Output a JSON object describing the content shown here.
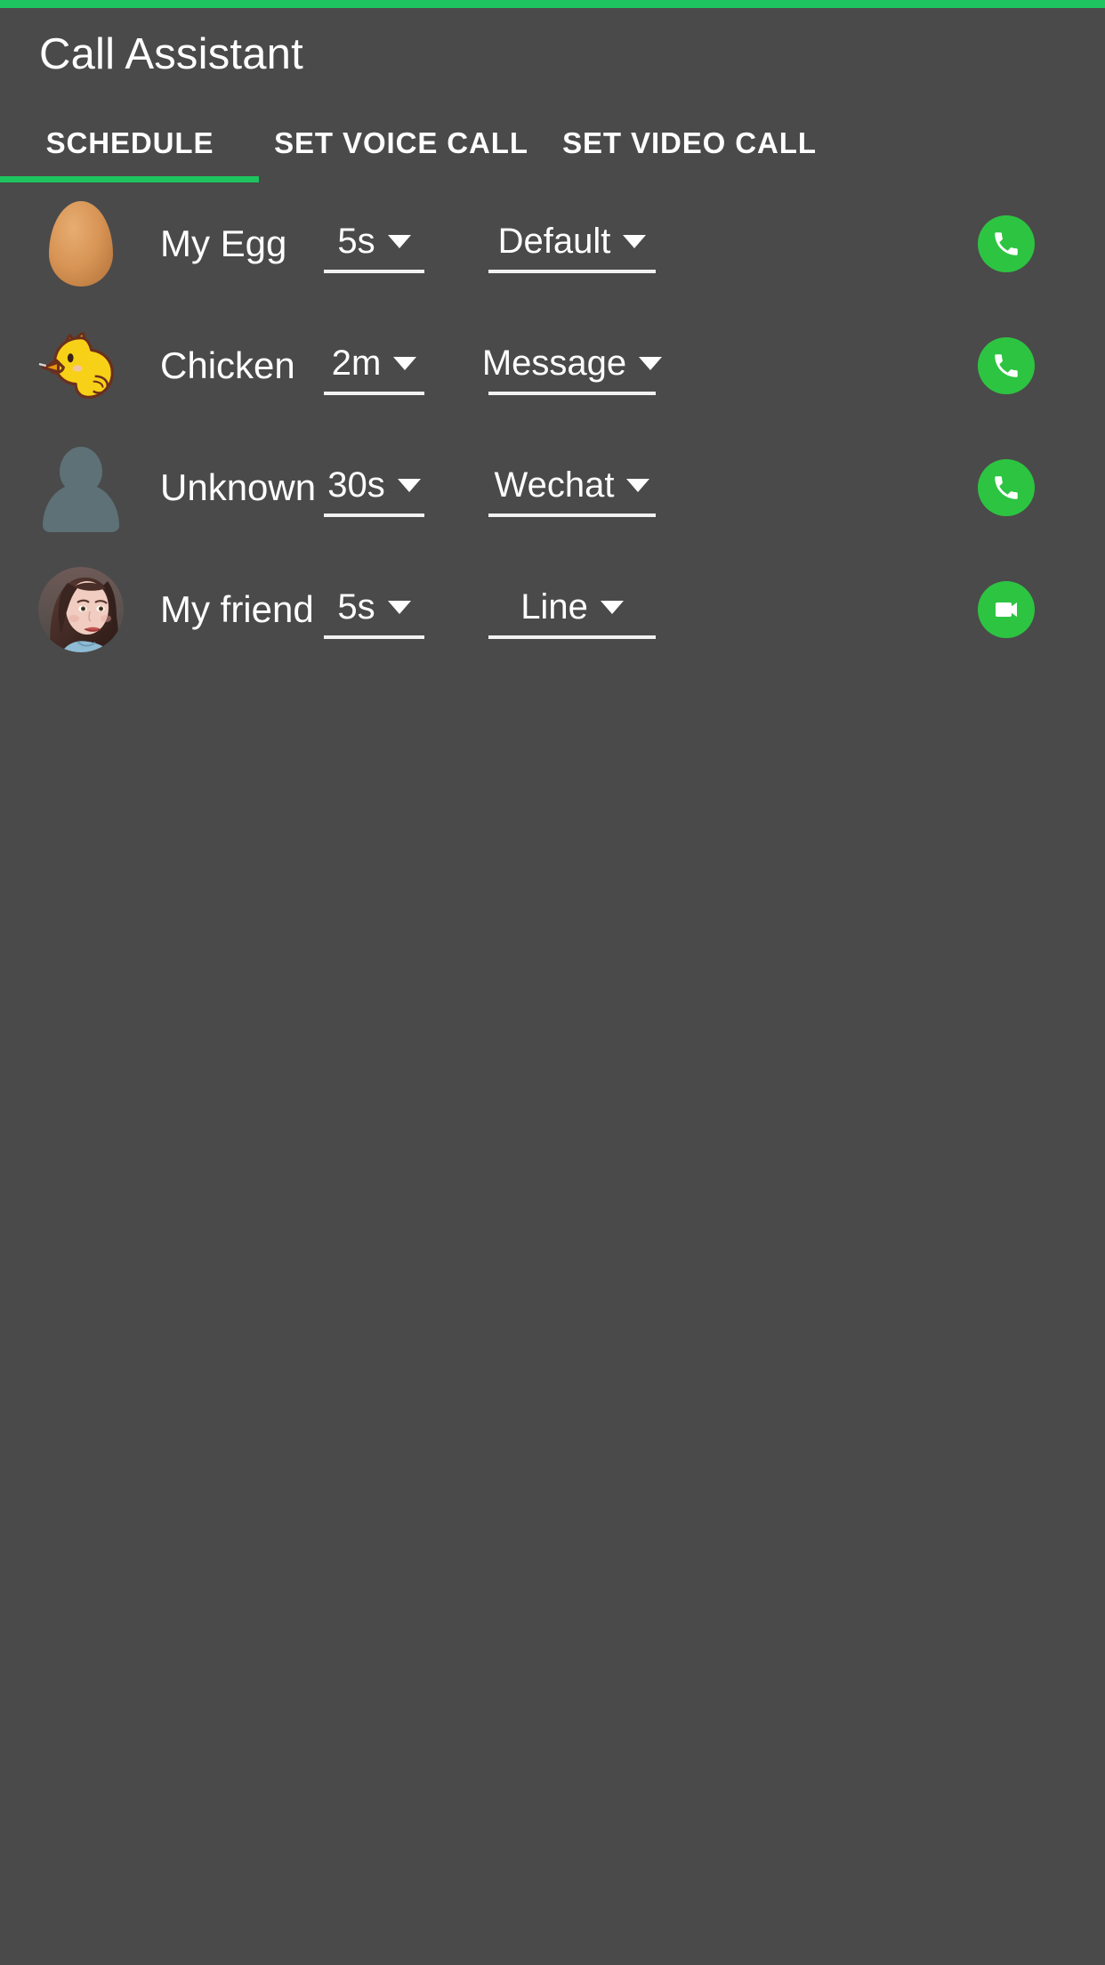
{
  "theme": {
    "background": "#4a4a4a",
    "accent_green": "#1ec45f",
    "action_green": "#2dc442",
    "text_primary": "#ffffff"
  },
  "app_bar": {
    "title": "Call Assistant"
  },
  "tabs": [
    {
      "label": "SCHEDULE",
      "selected": true,
      "name": "tab-schedule"
    },
    {
      "label": "SET VOICE CALL",
      "selected": false,
      "name": "tab-voice-call"
    },
    {
      "label": "SET VIDEO CALL",
      "selected": false,
      "name": "tab-video-call"
    }
  ],
  "schedule_rows": [
    {
      "avatar_kind": "egg",
      "avatar_icon": "egg-avatar-icon",
      "name": "My Egg",
      "delay": "5s",
      "channel": "Default",
      "action_icon": "phone-icon",
      "action_kind": "voice"
    },
    {
      "avatar_kind": "chick",
      "avatar_icon": "chick-avatar-icon",
      "name": "Chicken",
      "delay": "2m",
      "channel": "Message",
      "action_icon": "phone-icon",
      "action_kind": "voice"
    },
    {
      "avatar_kind": "silhouette",
      "avatar_icon": "person-silhouette-icon",
      "name": "Unknown",
      "delay": "30s",
      "channel": "Wechat",
      "action_icon": "phone-icon",
      "action_kind": "voice"
    },
    {
      "avatar_kind": "photo",
      "avatar_icon": "contact-photo-avatar",
      "name": "My friend",
      "delay": "5s",
      "channel": "Line",
      "action_icon": "video-camera-icon",
      "action_kind": "video"
    }
  ]
}
